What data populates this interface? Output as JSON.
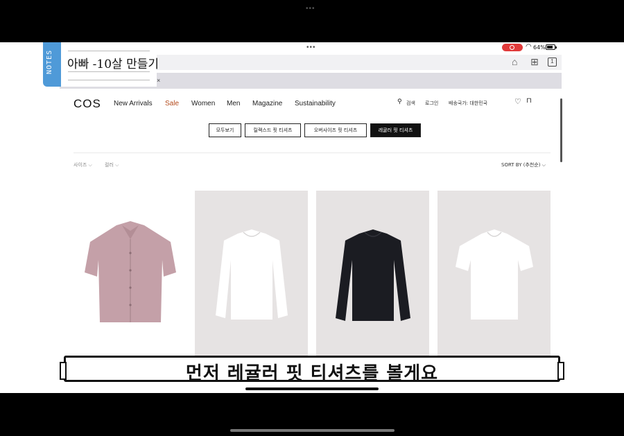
{
  "status": {
    "battery": "64%"
  },
  "browser": {
    "tabs_count": "1"
  },
  "notes": {
    "tab_label": "NOTES",
    "text": "아빠 -10살 만들기",
    "close": "×"
  },
  "site": {
    "logo": "COS",
    "nav": [
      "New Arrivals",
      "Sale",
      "Women",
      "Men",
      "Magazine",
      "Sustainability"
    ],
    "search_label": "검색",
    "login_label": "로그인",
    "shipping_label": "배송국가: 대한민국"
  },
  "filters": {
    "chips": [
      "모두보기",
      "릴랙스드 핏 티셔츠",
      "오버사이즈 핏 티셔츠",
      "레귤러 핏 티셔츠"
    ],
    "active": 3,
    "size_label": "사이즈 ⌵",
    "color_label": "컬러 ⌵",
    "sort_label": "SORT BY (추천순) ⌵"
  },
  "products": [
    {
      "name": "pink-short-sleeve-shirt",
      "color": "#c4a0a8",
      "bg": "#ffffff"
    },
    {
      "name": "white-long-sleeve-tshirt",
      "color": "#ffffff",
      "bg": "#e6e3e3"
    },
    {
      "name": "black-long-sleeve-tshirt",
      "color": "#1b1c22",
      "bg": "#e6e3e3"
    },
    {
      "name": "white-short-sleeve-tshirt",
      "color": "#ffffff",
      "bg": "#e6e3e3"
    }
  ],
  "caption": {
    "text": "먼저 레귤러 핏 티셔츠를 볼게요"
  },
  "colors": {
    "sale": "#b34a1b",
    "notes_tab": "#4f9ad8",
    "record": "#e03a3a"
  }
}
